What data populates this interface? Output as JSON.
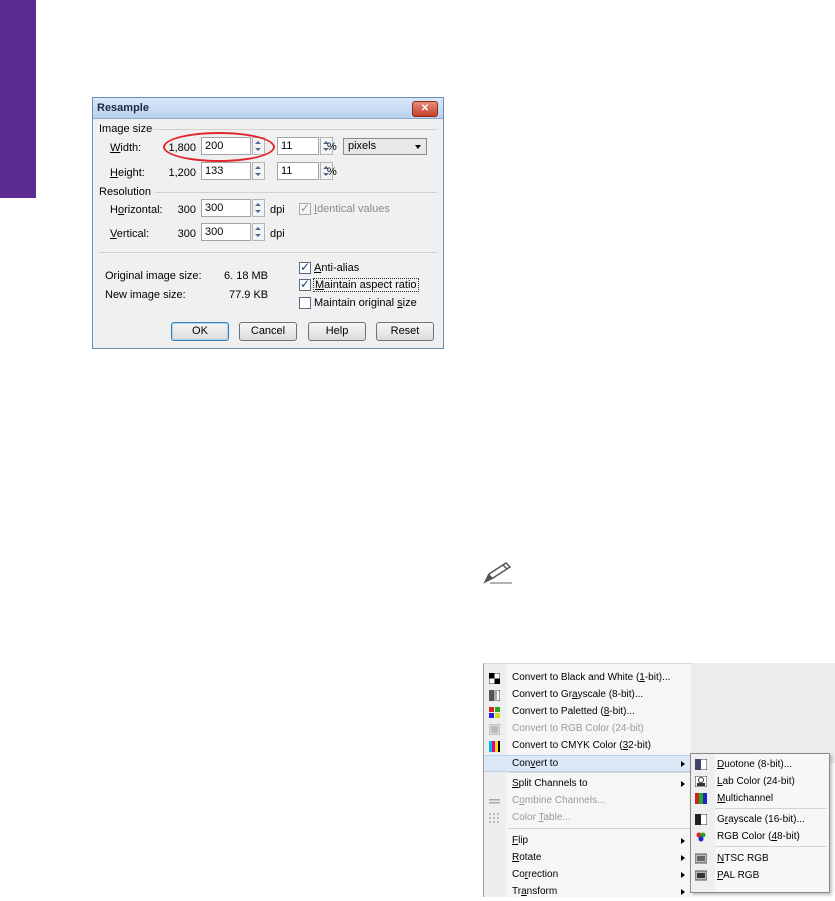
{
  "dialog": {
    "title": "Resample",
    "close_glyph": "✕",
    "image_size": {
      "group_label": "Image size",
      "width": {
        "label_pre": "",
        "label_u": "W",
        "label_post": "idth:",
        "original": "1,800",
        "value": "200",
        "percent": "11",
        "unit_symbol": "%"
      },
      "height": {
        "label_pre": "",
        "label_u": "H",
        "label_post": "eight:",
        "original": "1,200",
        "value": "133",
        "percent": "11",
        "unit_symbol": "%"
      },
      "units_selected": "pixels"
    },
    "resolution": {
      "group_label": "Resolution",
      "horizontal": {
        "label_pre": "H",
        "label_u": "o",
        "label_post": "rizontal:",
        "original": "300",
        "value": "300",
        "unit": "dpi"
      },
      "vertical": {
        "label_pre": "",
        "label_u": "V",
        "label_post": "ertical:",
        "original": "300",
        "value": "300",
        "unit": "dpi"
      },
      "identical_values": {
        "label_u": "I",
        "label_post": "dentical values",
        "checked": true,
        "disabled": true
      }
    },
    "info": {
      "original_label": "Original image size:",
      "original_value": "6. 18 MB",
      "new_label": "New image size:",
      "new_value": "77.9 KB"
    },
    "options": {
      "anti_alias": {
        "label_u": "A",
        "label_post": "nti-alias",
        "checked": true
      },
      "maintain_aspect": {
        "label_pre": "",
        "label_u": "M",
        "label_post": "aintain aspect ratio",
        "checked": true
      },
      "maintain_original": {
        "label_pre": "Maintain original ",
        "label_u": "s",
        "label_post": "ize",
        "checked": false
      }
    },
    "buttons": {
      "ok": "OK",
      "cancel": "Cancel",
      "help": "Help",
      "reset": "Reset"
    }
  },
  "icons": {
    "pencil": "pencil-icon"
  },
  "context_menu": {
    "items": [
      {
        "pre": "Convert to Black and White (",
        "u": "1",
        "post": "-bit)...",
        "disabled": false,
        "icon": "bw-icon"
      },
      {
        "pre": "Convert to Gr",
        "u": "a",
        "post": "yscale (8-bit)...",
        "disabled": false,
        "icon": "grayscale-icon"
      },
      {
        "pre": "Convert to Paletted (",
        "u": "8",
        "post": "-bit)...",
        "disabled": false,
        "icon": "paletted-icon"
      },
      {
        "pre": "Convert to RGB Color (24-bit)",
        "u": "",
        "post": "",
        "disabled": true,
        "icon": "rgb-icon"
      },
      {
        "pre": "Convert to CMYK Color (",
        "u": "3",
        "post": "2-bit)",
        "disabled": false,
        "icon": "cmyk-icon"
      },
      {
        "pre": "Con",
        "u": "v",
        "post": "ert to",
        "disabled": false,
        "submenu": true,
        "hover": true
      },
      {
        "pre": "",
        "u": "S",
        "post": "plit Channels to",
        "disabled": false,
        "submenu": true
      },
      {
        "pre": "C",
        "u": "o",
        "post": "mbine Channels...",
        "disabled": true,
        "icon": "combine-icon"
      },
      {
        "pre": "Color ",
        "u": "T",
        "post": "able...",
        "disabled": true,
        "icon": "color-table-icon"
      },
      {
        "pre": "",
        "u": "F",
        "post": "lip",
        "disabled": false,
        "submenu": true
      },
      {
        "pre": "",
        "u": "R",
        "post": "otate",
        "disabled": false,
        "submenu": true
      },
      {
        "pre": "Co",
        "u": "r",
        "post": "rection",
        "disabled": false,
        "submenu": true
      },
      {
        "pre": "Tr",
        "u": "a",
        "post": "nsform",
        "disabled": false,
        "submenu": true
      }
    ],
    "submenu": [
      {
        "pre": "",
        "u": "D",
        "post": "uotone (8-bit)...",
        "icon": "duotone-icon"
      },
      {
        "pre": "",
        "u": "L",
        "post": "ab Color (24-bit)",
        "icon": "lab-icon"
      },
      {
        "pre": "",
        "u": "M",
        "post": "ultichannel",
        "icon": "multichannel-icon"
      },
      {
        "pre": "G",
        "u": "r",
        "post": "ayscale (16-bit)...",
        "icon": "grayscale16-icon"
      },
      {
        "pre": "RGB Color (",
        "u": "4",
        "post": "8-bit)",
        "icon": "rgb48-icon"
      },
      {
        "pre": "",
        "u": "N",
        "post": "TSC RGB",
        "icon": "ntsc-icon"
      },
      {
        "pre": "",
        "u": "P",
        "post": "AL RGB",
        "icon": "pal-icon"
      }
    ]
  }
}
